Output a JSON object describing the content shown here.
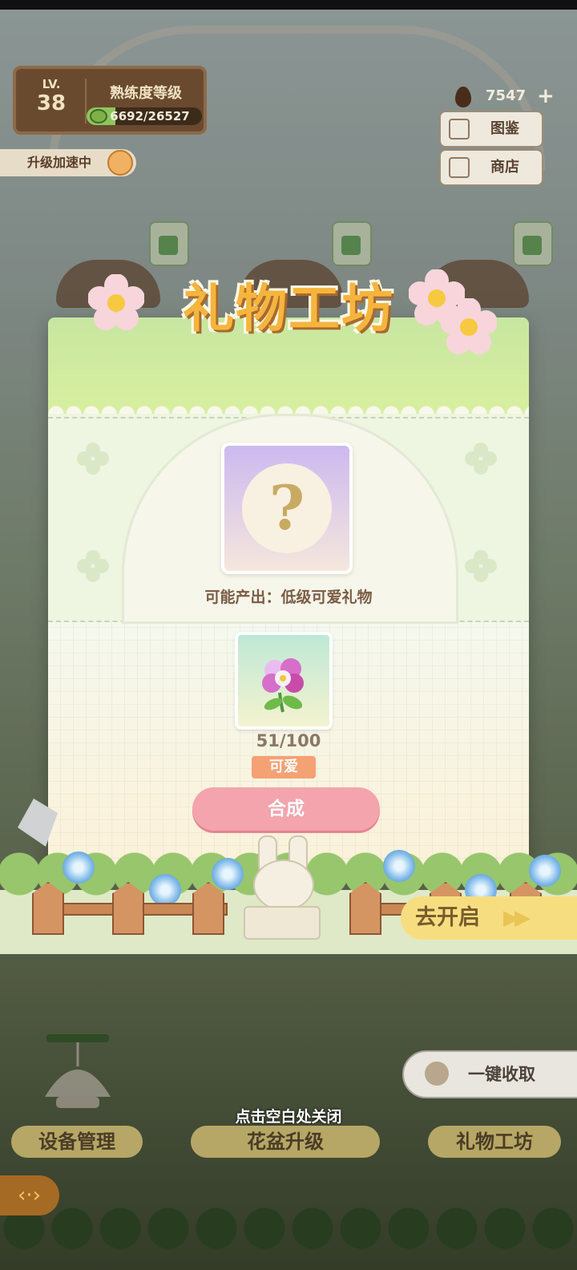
{
  "hud": {
    "level_label": "LV.",
    "level_value": "38",
    "mastery_title": "熟练度等级",
    "xp_text": "6692/26527",
    "xp_progress": 0.252,
    "boost_text": "升级加速中",
    "currency_amount": "7547",
    "currency_plus": "+",
    "catalog_label": "图鉴",
    "shop_label": "商店"
  },
  "modal": {
    "title": "礼物工坊",
    "mystery_symbol": "?",
    "possible_output": "可能产出：低级可爱礼物",
    "material_progress": "51/100",
    "material_tag": "可爱",
    "synthesize_label": "合成"
  },
  "go_open": {
    "label": "去开启",
    "arrows": "▶▶"
  },
  "bottom": {
    "collect_all_label": "一键收取",
    "device_manage_label": "设备管理",
    "pot_upgrade_label": "花盆升级",
    "gift_workshop_label": "礼物工坊",
    "close_hint": "点击空白处关闭",
    "back_glyph": "‹·›"
  },
  "colors": {
    "accent_green": "#c8e6a1",
    "synth_button": "#f4a4ad",
    "tag_orange": "#f4a173",
    "title_gold": "#f5b53d"
  }
}
